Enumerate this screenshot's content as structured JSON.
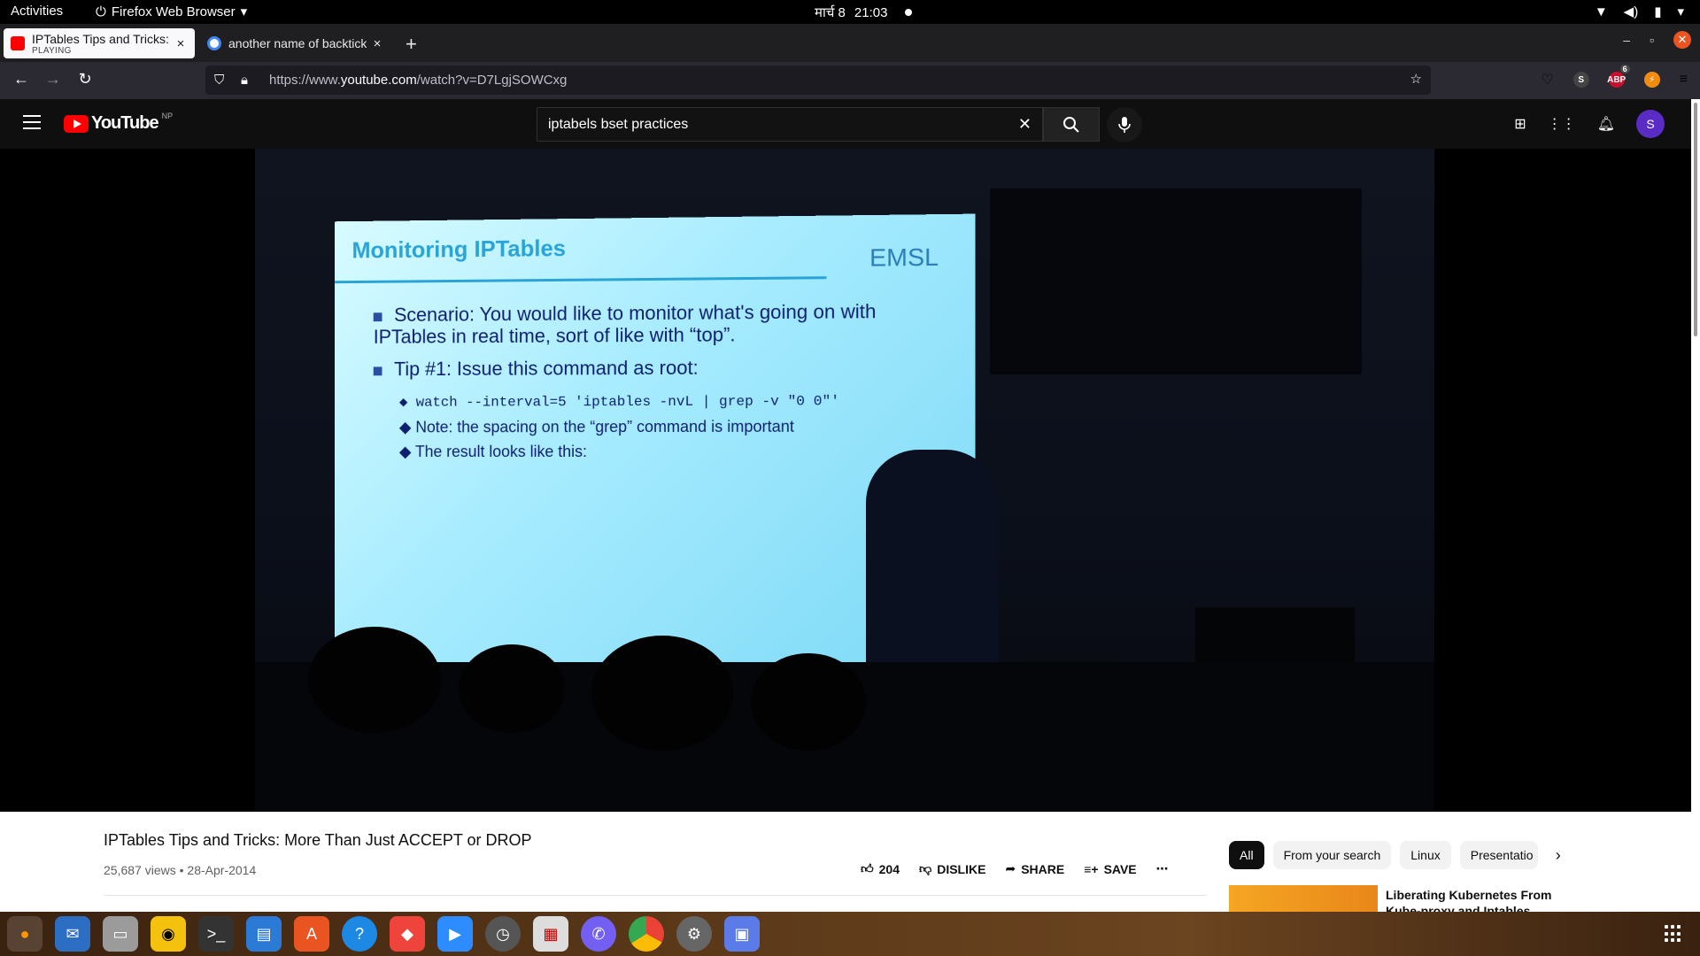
{
  "system": {
    "activities": "Activities",
    "app_menu": "Firefox Web Browser",
    "date": "मार्च 8",
    "time": "21:03"
  },
  "tabs": [
    {
      "title": "IPTables Tips and Tricks: M",
      "subtitle": "PLAYING",
      "favicon_color": "#ff0000"
    },
    {
      "title": "another name of backtick",
      "favicon_color": "#4285f4"
    }
  ],
  "navbar": {
    "url_prefix": "https://www.",
    "url_domain": "youtube.com",
    "url_path": "/watch?v=D7LgjSOWCxg",
    "abp_badge": "6"
  },
  "youtube": {
    "logo_text": "YouTube",
    "region": "NP",
    "search_value": "iptabels bset practices",
    "search_placeholder": "Search",
    "avatar_letter": "S"
  },
  "slide": {
    "title": "Monitoring IPTables",
    "brand": "EMSL",
    "bullet1": "Scenario: You would like to monitor what's going on with IPTables in real time, sort of like with “top”.",
    "bullet2": "Tip #1: Issue this command as root:",
    "sub1": "watch --interval=5 'iptables -nvL | grep -v \"0     0\"'",
    "sub2": "Note: the spacing on the “grep” command is important",
    "sub3": "The result looks like this:"
  },
  "video": {
    "title": "IPTables Tips and Tricks: More Than Just ACCEPT or DROP",
    "views": "25,687 views",
    "date": "28-Apr-2014",
    "likes": "204",
    "dislike_label": "DISLIKE",
    "share_label": "SHARE",
    "save_label": "SAVE"
  },
  "chips": [
    "All",
    "From your search",
    "Linux",
    "Presentatio"
  ],
  "recommendation": {
    "title": "Liberating Kubernetes From Kube-proxy and Iptables"
  }
}
